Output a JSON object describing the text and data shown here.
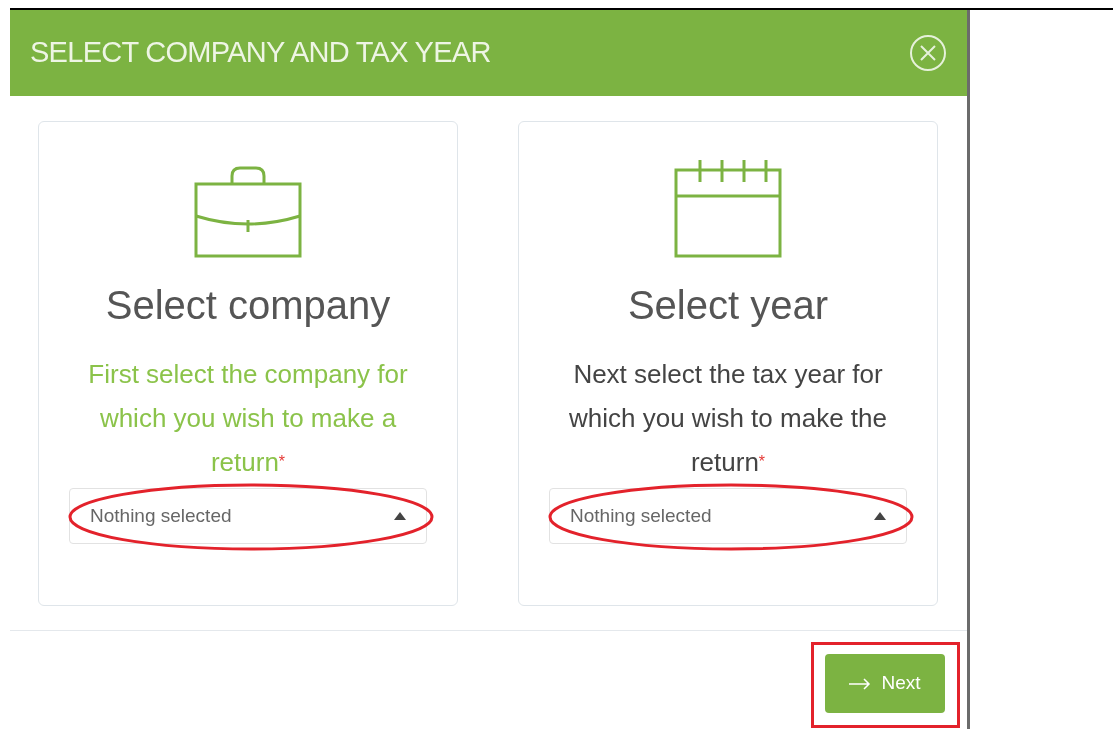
{
  "dialog": {
    "title": "SELECT COMPANY AND TAX YEAR",
    "cards": [
      {
        "kind": "company",
        "heading": "Select company",
        "active": true,
        "text": "First select the company for which you wish to make a return",
        "required_mark": "*",
        "select": {
          "value": "Nothing selected",
          "highlighted": true
        }
      },
      {
        "kind": "calendar",
        "heading": "Select year",
        "active": false,
        "text": "Next select the tax year for which you wish to make the return",
        "required_mark": "*",
        "select": {
          "value": "Nothing selected",
          "highlighted": true
        }
      }
    ],
    "next_button": {
      "label": "Next",
      "highlighted": true
    }
  }
}
